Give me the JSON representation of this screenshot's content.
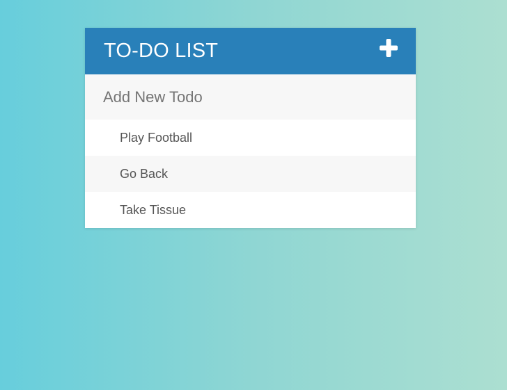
{
  "header": {
    "title": "TO-DO LIST",
    "add_icon": "plus-icon"
  },
  "input": {
    "placeholder": "Add New Todo",
    "value": ""
  },
  "todos": [
    {
      "text": "Play Football"
    },
    {
      "text": "Go Back"
    },
    {
      "text": "Take Tissue"
    }
  ],
  "colors": {
    "header_bg": "#2980b9",
    "header_text": "#ffffff",
    "input_bg": "#f7f7f7",
    "item_text": "#555555",
    "background_left": "#67cedc",
    "background_right": "#acdfd1"
  }
}
